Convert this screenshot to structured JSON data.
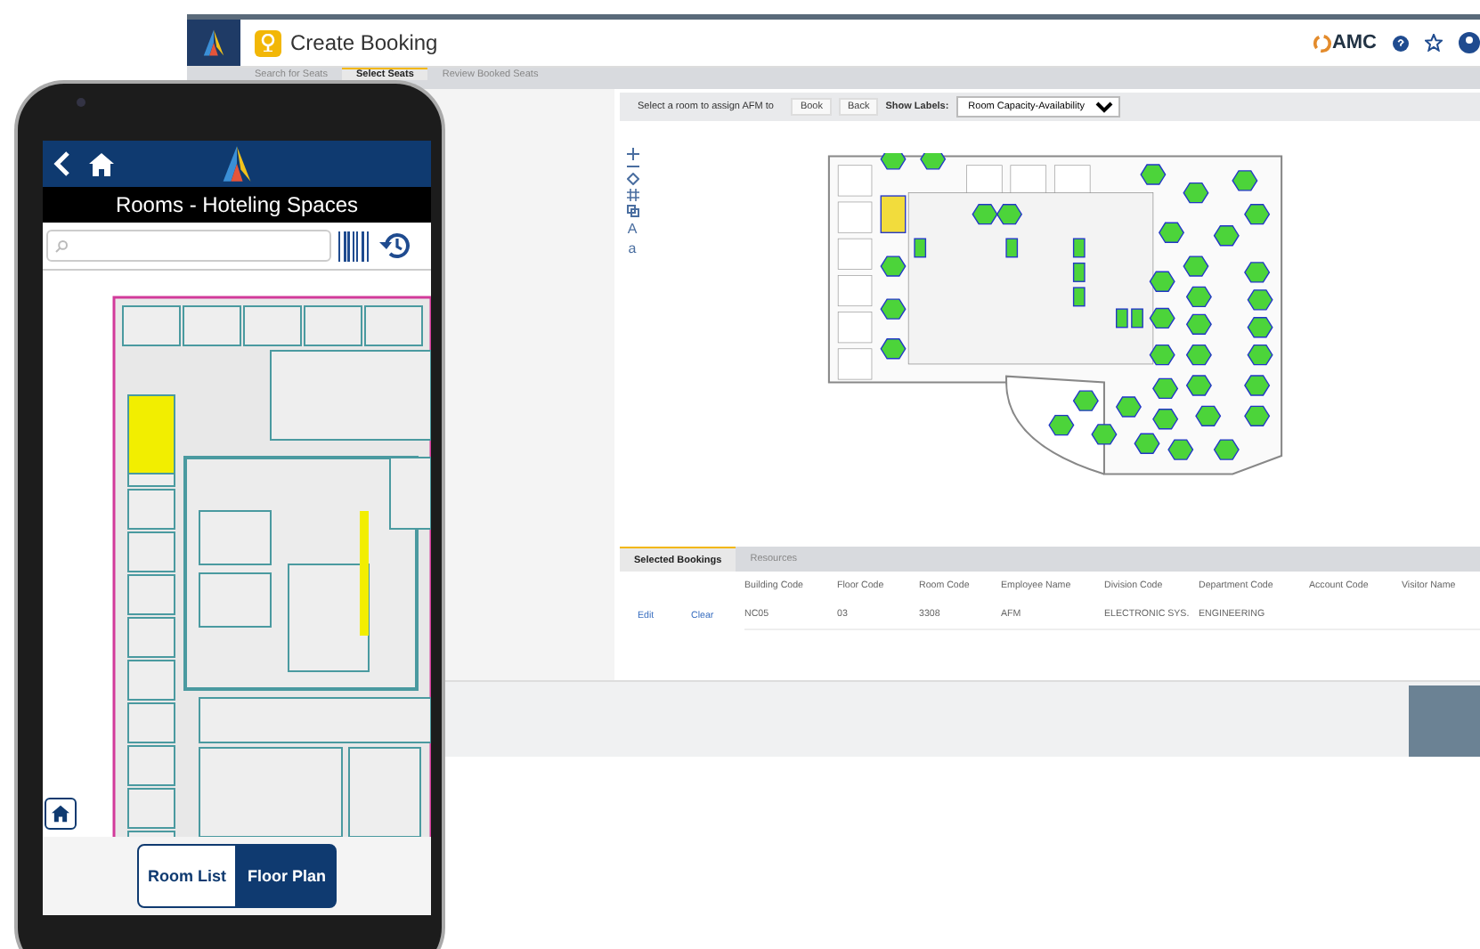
{
  "desktop": {
    "title": "Create Booking",
    "brand": "AMC",
    "tabs": [
      {
        "label": "Search for Seats",
        "selected": false
      },
      {
        "label": "Select Seats",
        "selected": true
      },
      {
        "label": "Review Booked Seats",
        "selected": false
      }
    ],
    "toolbar": {
      "prompt": "Select a room to assign AFM to",
      "buttons": [
        "Book",
        "Back"
      ],
      "labels_caption": "Show Labels:",
      "labels_value": "Room Capacity-Availability"
    },
    "map_tools": [
      "A",
      "a"
    ],
    "bookings": {
      "tabs": [
        {
          "label": "Selected Bookings",
          "selected": true
        },
        {
          "label": "Resources",
          "selected": false
        }
      ],
      "columns": [
        "Building Code",
        "Floor Code",
        "Room Code",
        "Employee Name",
        "Division Code",
        "Department Code",
        "Account Code",
        "Visitor Name"
      ],
      "rows": [
        {
          "actions": [
            "Edit",
            "Clear"
          ],
          "cells": [
            "NC05",
            "03",
            "3308",
            "AFM",
            "ELECTRONIC SYS.",
            "ENGINEERING"
          ]
        }
      ]
    }
  },
  "phone": {
    "title": "Rooms - Hoteling Spaces",
    "toggle": [
      {
        "label": "Room List",
        "selected": false
      },
      {
        "label": "Floor Plan",
        "selected": true
      }
    ]
  }
}
